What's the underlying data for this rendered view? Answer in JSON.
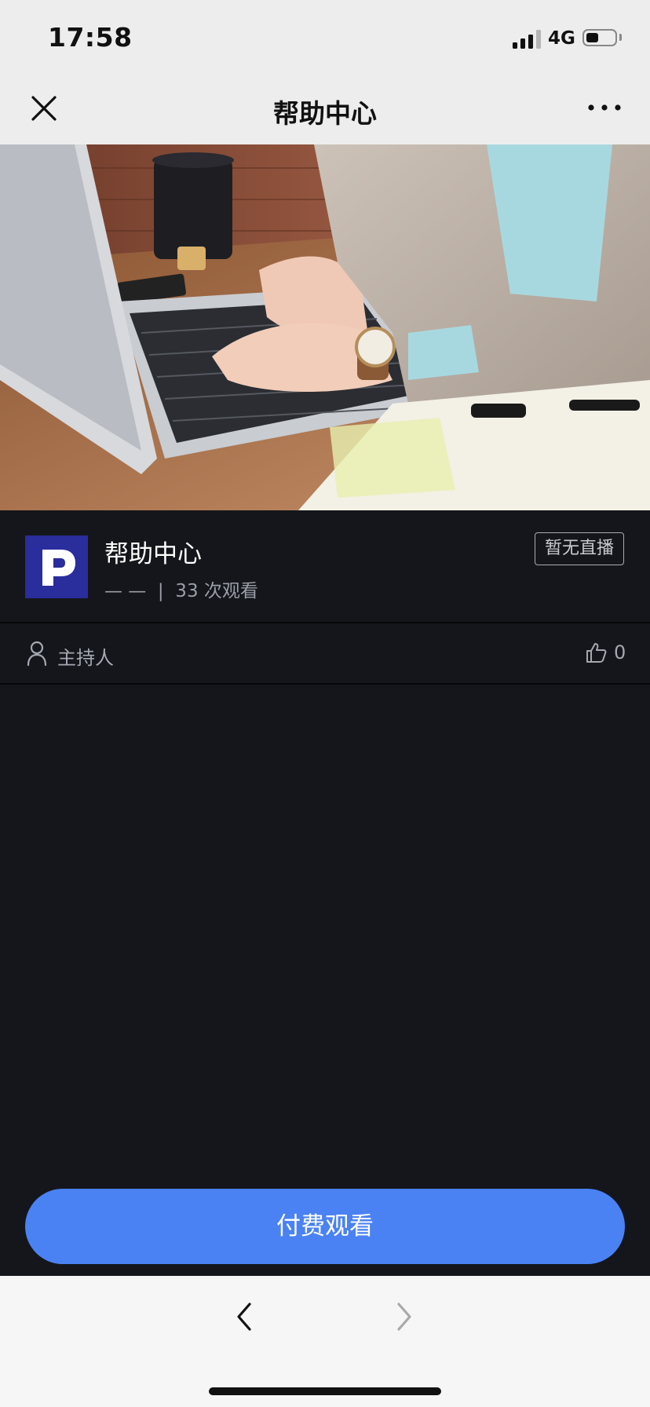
{
  "status_bar": {
    "time": "17:58",
    "network": "4G"
  },
  "nav": {
    "title": "帮助中心"
  },
  "banner": {
    "image_icon": "laptop-desk-photo"
  },
  "course": {
    "logo_letter": "P",
    "title": "帮助中心",
    "meta": "— —  |  33 次观看",
    "live_status": "暂无直播"
  },
  "host": {
    "label": "主持人",
    "like_count": "0"
  },
  "pay_button": {
    "label": "付费观看"
  },
  "colors": {
    "accent": "#4a82f3",
    "content_bg": "#14161b",
    "logo_bg": "#2a2d9c"
  }
}
